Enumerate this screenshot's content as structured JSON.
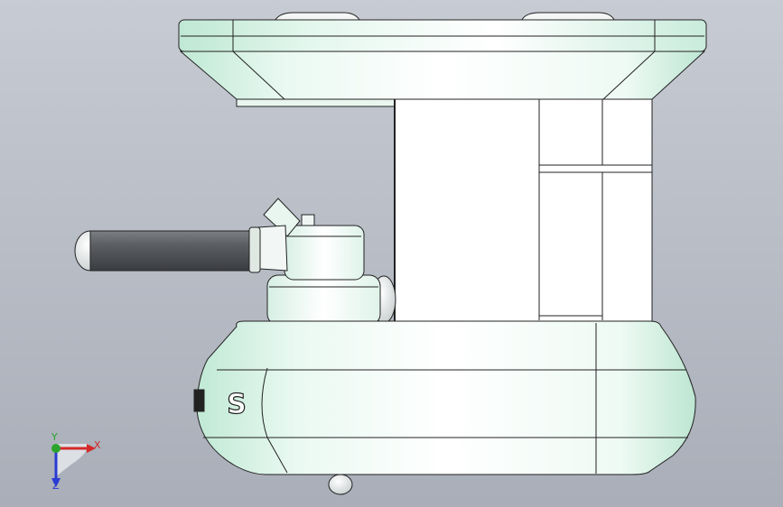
{
  "viewport": {
    "background_top": "#c7cbd3",
    "background_bottom": "#a9aeb8"
  },
  "model": {
    "body_color": "#ffffff",
    "tint_color": "#cfeee0",
    "handle_color": "#55585c",
    "logo_text": "S"
  },
  "triad": {
    "x_label": "X",
    "y_label": "Y",
    "z_label": "Z",
    "x_color": "#d42a2a",
    "y_color": "#2aa42a",
    "z_color": "#2a3ad4"
  }
}
